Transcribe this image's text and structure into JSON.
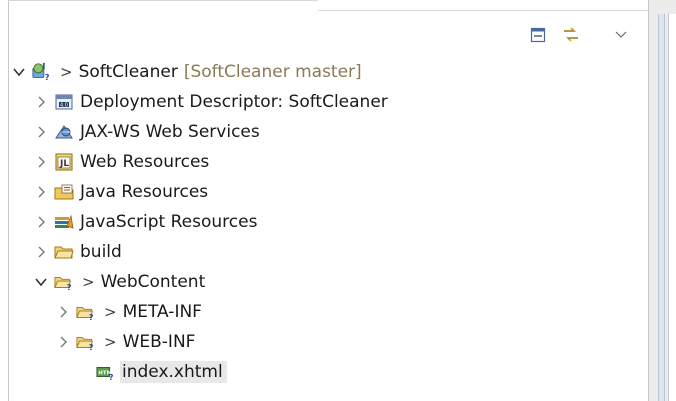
{
  "toolbar": {
    "collapse_all_icon": "collapse-all-icon",
    "link_editor_icon": "link-with-editor-icon",
    "view_menu_icon": "view-menu-chevron-icon"
  },
  "tree": {
    "project": {
      "label": "SoftCleaner",
      "repo": "[SoftCleaner master]",
      "prefix": ">"
    },
    "items": [
      {
        "label": "Deployment Descriptor: SoftCleaner"
      },
      {
        "label": "JAX-WS Web Services"
      },
      {
        "label": "Web Resources"
      },
      {
        "label": "Java Resources"
      },
      {
        "label": "JavaScript Resources"
      },
      {
        "label": "build"
      }
    ],
    "webcontent": {
      "prefix": ">",
      "label": "WebContent",
      "children": [
        {
          "prefix": ">",
          "label": "META-INF"
        },
        {
          "prefix": ">",
          "label": "WEB-INF"
        }
      ],
      "file": {
        "label": "index.xhtml"
      }
    }
  },
  "colors": {
    "selection": "#e8e8e8",
    "repo_text": "#8a7a55",
    "folder": "#e8c25a"
  }
}
